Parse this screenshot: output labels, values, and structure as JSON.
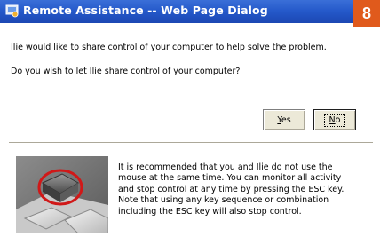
{
  "window": {
    "title": "Remote Assistance -- Web Page Dialog"
  },
  "badge": {
    "number": "8"
  },
  "message": {
    "line1": "Ilie would like to share control of your computer to help solve the problem.",
    "line2": "Do you wish to let Ilie share control of your computer?"
  },
  "buttons": {
    "yes_label": "Yes",
    "yes_access_key": "Y",
    "yes_rest": "es",
    "no_label": "No",
    "no_access_key": "N",
    "no_rest": "o"
  },
  "info": {
    "lines": [
      "It is recommended that you and Ilie  do not use the",
      "mouse at the same time. You can monitor all activity",
      "and stop control at any time by pressing the ESC key.",
      "Note that using any key sequence or combination",
      "including the ESC key will also stop control."
    ]
  },
  "icons": {
    "title_icon": "remote-assistance-icon",
    "photo": "esc-key-photo"
  },
  "colors": {
    "titlebar": "#2458c9",
    "badge": "#e05a1c",
    "highlight_circle": "#d01818"
  }
}
